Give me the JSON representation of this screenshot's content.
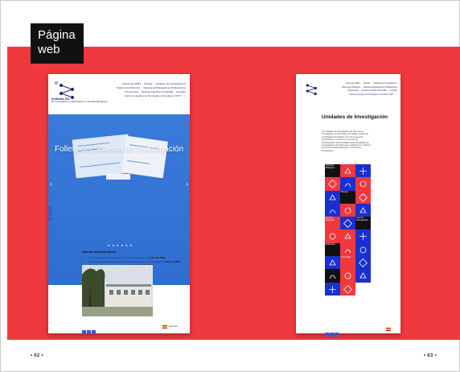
{
  "label": {
    "line1": "Página",
    "line2": "web"
  },
  "folio": {
    "left": "• 62 •",
    "right": "• 63 •"
  },
  "colors": {
    "band": "#f0393f",
    "brand_blue": "#2e6ed0",
    "nav_blue": "#20286b",
    "tile_red": "#f0393f",
    "tile_blue": "#1a2fd0",
    "tile_black": "#111111"
  },
  "left_site": {
    "logo_text": {
      "name": "Instituto Do",
      "sub": "de Investigación y Desarrollo en Ciencias Biológicas"
    },
    "nav": [
      "Acerca del IIDB ▾",
      "Noticias",
      "Unidades de Investigación ▾",
      "Sistema de Distinción",
      "Sistema de Búsqueda de Publicaciones",
      "Documentos",
      "Revista Científica CCGQ/INE",
      "Contacto",
      "Centro de ayuda a la Tecnología e Innovación CATI ▾"
    ],
    "hero_title": "Folleto del Sistema de Investigación",
    "slide_dots": "● ● ● ● ● ●",
    "news_heading": "Nuevas publicaciones",
    "news_items": [
      {
        "text": "Curso introductorio al manejo del software estadístico SS",
        "date": "julio 22, 2020"
      },
      {
        "text": "Conferencia Importancia de la propiedad intelectual en la investigación",
        "date": "mayo 5, 2020"
      },
      {
        "text": "Biólogos destacan en revista internacional",
        "date": "febrero 24, 2020"
      }
    ],
    "footer_lang": "Español"
  },
  "right_site": {
    "nav": [
      "Acerca del IIDB ▾",
      "Noticias",
      "Unidades de Investigación ▾",
      "Sistema de Distinción",
      "Sistema de Búsqueda de Publicaciones",
      "Documentos",
      "Revista Científica CCGQ/INE",
      "Contacto",
      "Centro de ayuda a la Tecnología e Innovación CATI"
    ],
    "title": "Unidades de Investigación",
    "body": "Las Unidades de Investigación del Sistema de Investigación son las células del trabajo científico de investigación del Instituto con el fin de generar conocimiento y contribuir con su área de especialización. Estas unidades están integradas por investigadores del Instituto que colaboran en conjunto y de manera interdisciplinaria en proyectos de investigación.",
    "tile_captions": [
      "Sistemas Biológicos",
      "",
      "",
      "",
      "",
      "",
      "",
      "Biología",
      "",
      "",
      "",
      "",
      "Química Ambiental",
      "",
      "Química Farmacéutica",
      "",
      "",
      "",
      "Estadística",
      "",
      "",
      "",
      "Toxicología",
      "",
      "",
      "",
      "",
      "",
      ""
    ],
    "footer_lang": "Español"
  }
}
